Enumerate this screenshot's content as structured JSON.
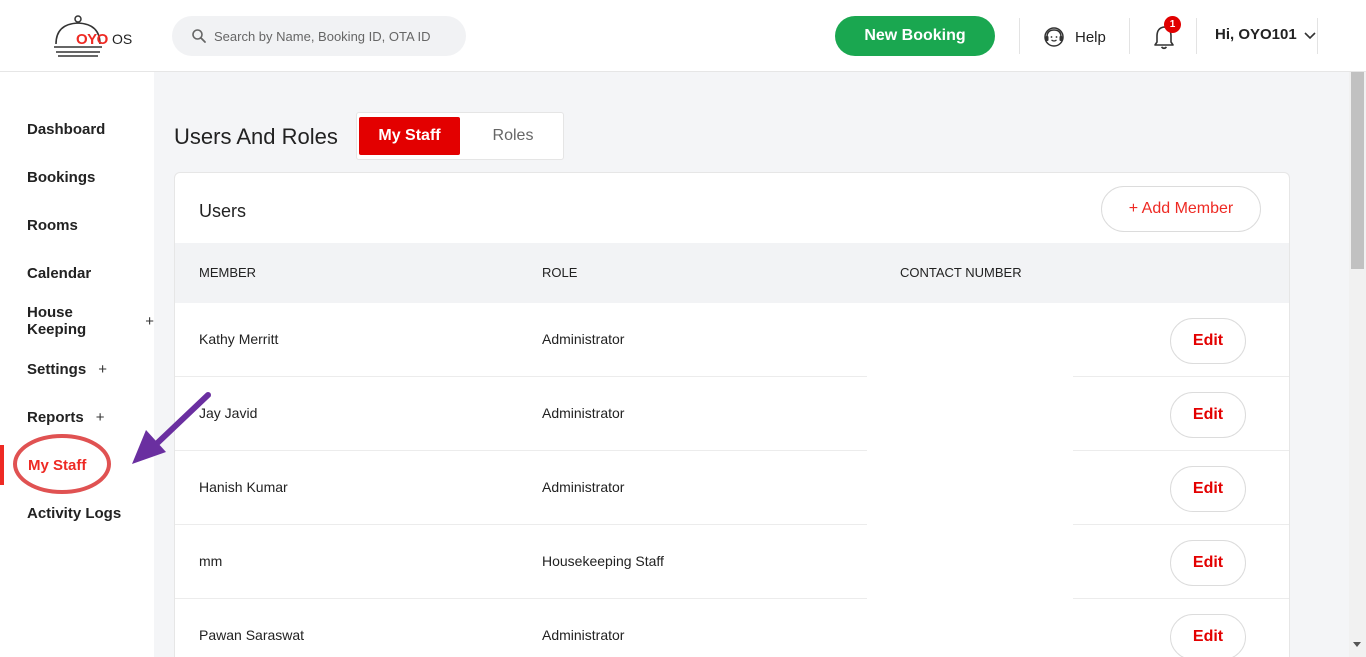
{
  "header": {
    "logo_text": "OYO",
    "logo_suffix": "OS",
    "search_placeholder": "Search by Name, Booking ID, OTA ID",
    "new_booking_label": "New Booking",
    "help_label": "Help",
    "notification_count": "1",
    "user_greeting": "Hi, OYO101"
  },
  "sidebar": {
    "items": [
      {
        "label": "Dashboard",
        "expandable": ""
      },
      {
        "label": "Bookings",
        "expandable": ""
      },
      {
        "label": "Rooms",
        "expandable": ""
      },
      {
        "label": "Calendar",
        "expandable": ""
      },
      {
        "label": "House Keeping",
        "expandable": "+"
      },
      {
        "label": "Settings",
        "expandable": "+"
      },
      {
        "label": "Reports",
        "expandable": "+"
      },
      {
        "label": "My Staff",
        "expandable": ""
      },
      {
        "label": "Activity Logs",
        "expandable": ""
      }
    ],
    "active_item": "My Staff"
  },
  "main": {
    "page_title": "Users And Roles",
    "tabs": [
      {
        "label": "My Staff",
        "active": true
      },
      {
        "label": "Roles",
        "active": false
      }
    ],
    "card_title": "Users",
    "add_member_label": "+  Add Member",
    "columns": [
      "MEMBER",
      "ROLE",
      "CONTACT NUMBER"
    ],
    "rows": [
      {
        "member": "Kathy Merritt",
        "role": "Administrator",
        "action": "Edit"
      },
      {
        "member": "Jay Javid",
        "role": "Administrator",
        "action": "Edit"
      },
      {
        "member": "Hanish Kumar",
        "role": "Administrator",
        "action": "Edit"
      },
      {
        "member": "mm",
        "role": "Housekeeping Staff",
        "action": "Edit"
      },
      {
        "member": "Pawan Saraswat",
        "role": "Administrator",
        "action": "Edit"
      }
    ]
  },
  "colors": {
    "brand_red": "#ee2a24",
    "primary_green": "#1aa750",
    "annotation_circle": "#e05252",
    "annotation_arrow": "#6a2fa0"
  }
}
